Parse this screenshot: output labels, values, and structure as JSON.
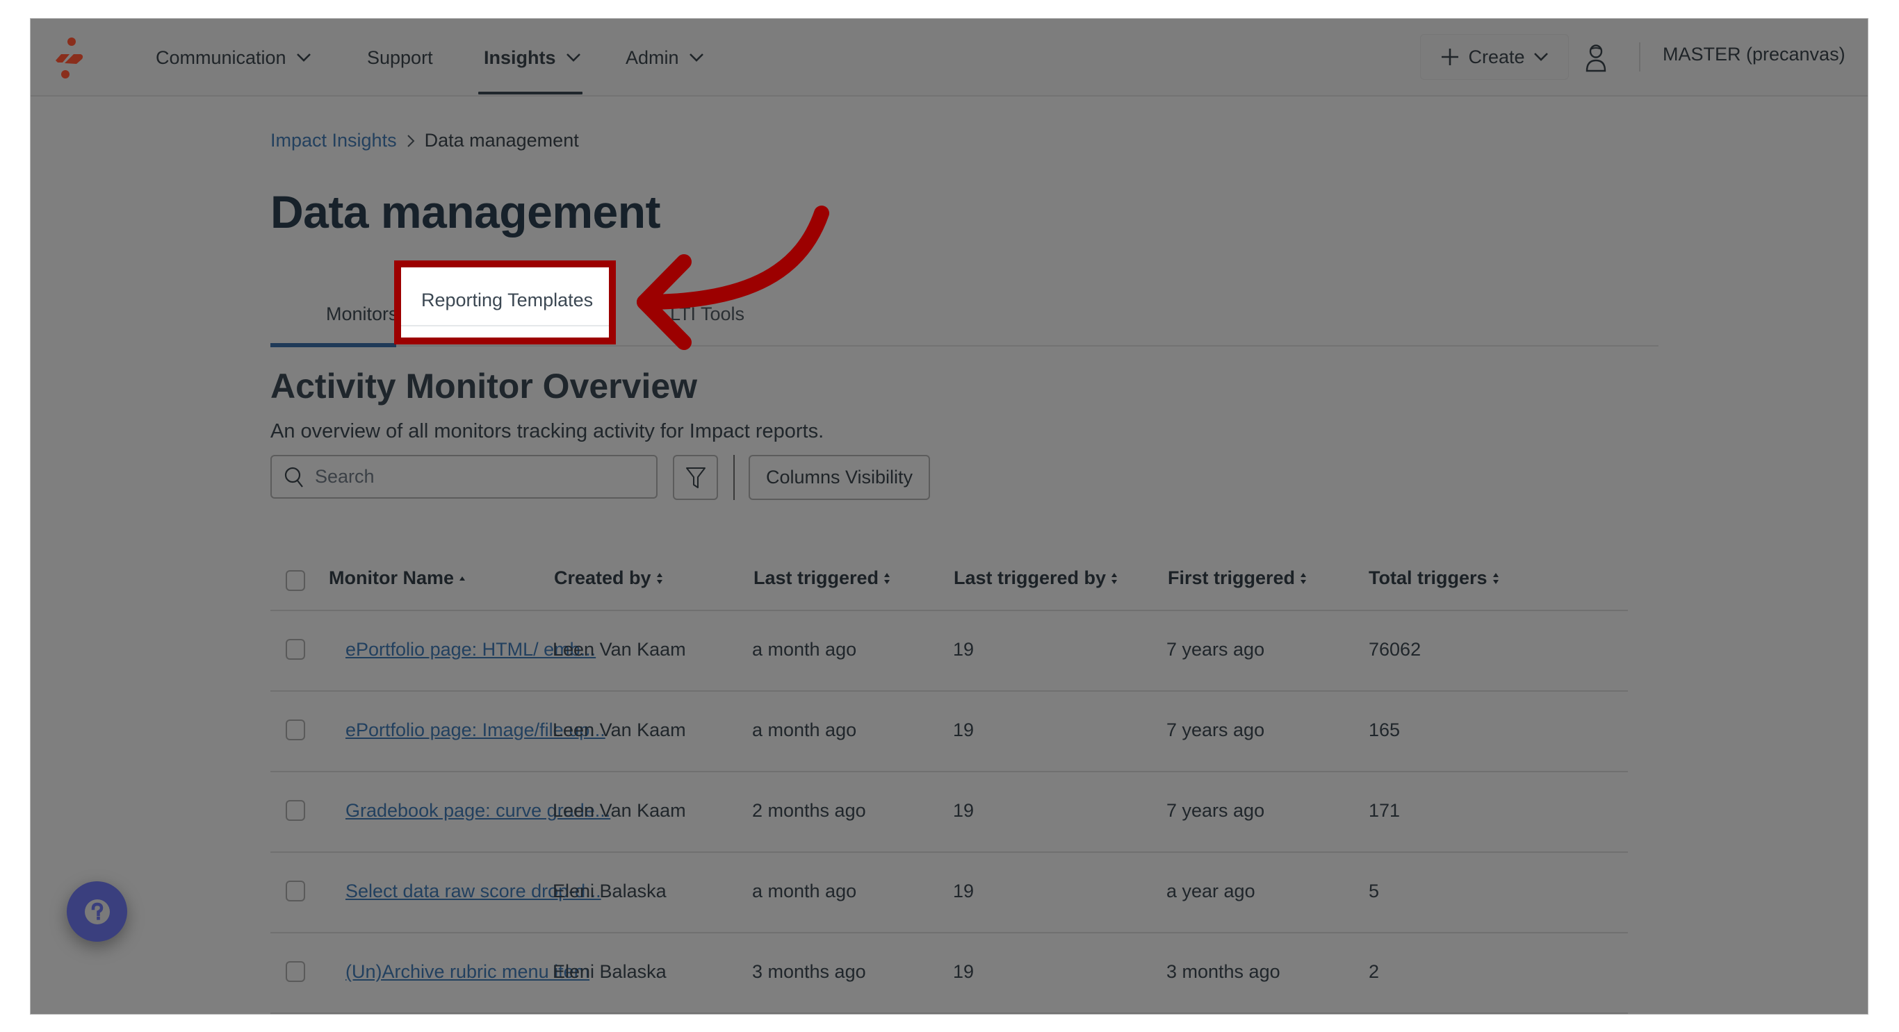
{
  "nav": {
    "items": [
      {
        "label": "Communication",
        "has_dropdown": true,
        "active": false
      },
      {
        "label": "Support",
        "has_dropdown": false,
        "active": false
      },
      {
        "label": "Insights",
        "has_dropdown": true,
        "active": true
      },
      {
        "label": "Admin",
        "has_dropdown": true,
        "active": false
      }
    ],
    "create_label": "Create",
    "account_label": "MASTER (precanvas)"
  },
  "breadcrumb": {
    "parent": "Impact Insights",
    "current": "Data management"
  },
  "page_title": "Data management",
  "tabs": [
    {
      "label": "Monitors",
      "active": true
    },
    {
      "label": "Reporting Templates",
      "active": false,
      "highlighted": true
    },
    {
      "label": "LTI Tools",
      "active": false,
      "obscured": true
    }
  ],
  "annotation": {
    "highlight_color": "#9c0000",
    "arrow_color": "#9c0000",
    "arrow_points_to": "Reporting Templates"
  },
  "section": {
    "title": "Activity Monitor Overview",
    "description": "An overview of all monitors tracking activity for Impact reports."
  },
  "toolbar": {
    "search_placeholder": "Search",
    "search_value": "",
    "columns_visibility_label": "Columns Visibility"
  },
  "table": {
    "columns": [
      {
        "label": "Monitor Name",
        "sort": "ascending"
      },
      {
        "label": "Created by",
        "sort": "none"
      },
      {
        "label": "Last triggered",
        "sort": "none"
      },
      {
        "label": "Last triggered by",
        "sort": "none"
      },
      {
        "label": "First triggered",
        "sort": "none"
      },
      {
        "label": "Total triggers",
        "sort": "none"
      }
    ],
    "rows": [
      {
        "name": "ePortfolio page: HTML/ emb...",
        "created_by": "Leen Van Kaam",
        "last_triggered": "a month ago",
        "last_triggered_by": "19",
        "first_triggered": "7 years ago",
        "total_triggers": "76062"
      },
      {
        "name": "ePortfolio page: Image/file up...",
        "created_by": "Leen Van Kaam",
        "last_triggered": "a month ago",
        "last_triggered_by": "19",
        "first_triggered": "7 years ago",
        "total_triggers": "165"
      },
      {
        "name": "Gradebook page: curve grade...",
        "created_by": "Leen Van Kaam",
        "last_triggered": "2 months ago",
        "last_triggered_by": "19",
        "first_triggered": "7 years ago",
        "total_triggers": "171"
      },
      {
        "name": "Select data raw score drop-d...",
        "created_by": "Eleni Balaska",
        "last_triggered": "a month ago",
        "last_triggered_by": "19",
        "first_triggered": "a year ago",
        "total_triggers": "5"
      },
      {
        "name": "(Un)Archive rubric menu item",
        "created_by": "Eleni Balaska",
        "last_triggered": "3 months ago",
        "last_triggered_by": "19",
        "first_triggered": "3 months ago",
        "total_triggers": "2"
      }
    ]
  },
  "icons": {
    "logo": "brand-logo-icon",
    "chevron": "chevron-down-icon",
    "plus": "plus-icon",
    "user": "user-icon",
    "search": "search-icon",
    "filter": "filter-icon",
    "sort": "sort-icon",
    "help": "help-icon"
  },
  "colors": {
    "overlay_bg": "#7f7f7f",
    "brand": "#8a2e1c",
    "link": "#22405f",
    "active_tab": "#1f3a58",
    "help_button": "#3a3f7e"
  }
}
